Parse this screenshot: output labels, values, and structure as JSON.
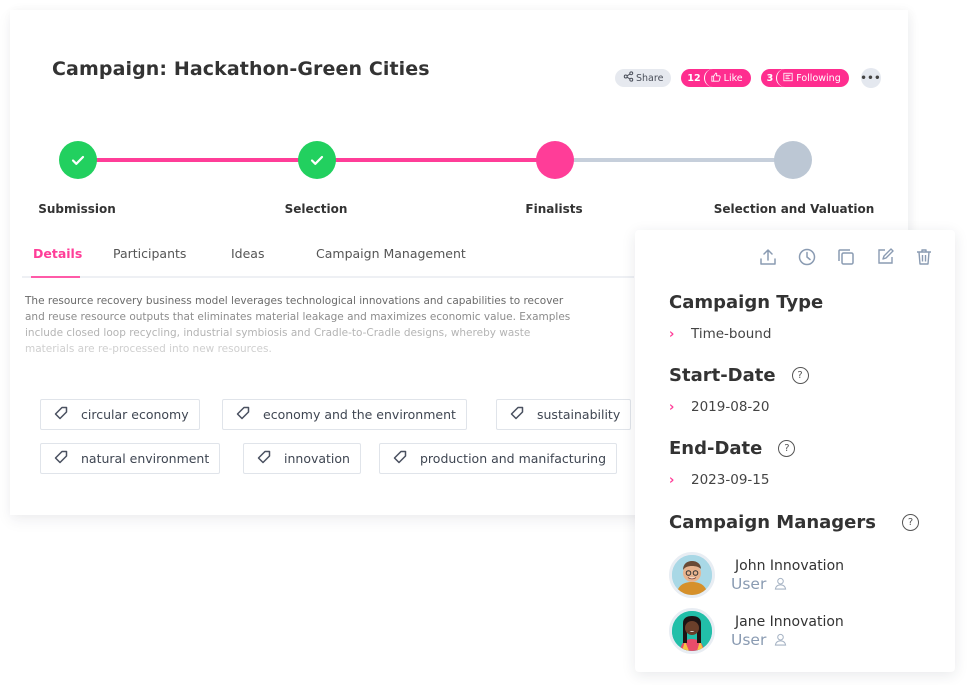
{
  "campaign": {
    "title": "Campaign: Hackathon-Green Cities"
  },
  "actions": {
    "share_label": "Share",
    "like_count": "12",
    "like_label": "Like",
    "following_count": "3",
    "following_label": "Following",
    "more_label": "•••"
  },
  "colors": {
    "accent": "#ff2d8f",
    "done": "#22d05f",
    "pending": "#bcc7d4",
    "line_done": "#ff3d98",
    "line_pending": "#c6cfdb"
  },
  "stepper": {
    "steps": [
      {
        "label": "Submission",
        "status": "completed"
      },
      {
        "label": "Selection",
        "status": "completed"
      },
      {
        "label": "Finalists",
        "status": "current"
      },
      {
        "label": "Selection and Valuation",
        "status": "pending"
      }
    ]
  },
  "tabs": [
    {
      "label": "Details",
      "active": true
    },
    {
      "label": "Participants",
      "active": false
    },
    {
      "label": "Ideas",
      "active": false
    },
    {
      "label": "Campaign Management",
      "active": false
    }
  ],
  "description": {
    "lines": [
      "The resource recovery business model leverages technological innovations and capabilities to recover",
      "and reuse resource outputs that eliminates material leakage and maximizes economic value. Examples",
      "include closed loop recycling, industrial symbiosis and Cradle-to-Cradle designs, whereby waste",
      "materials are re-processed into new resources."
    ]
  },
  "tags": [
    "circular economy",
    "economy and the environment",
    "sustainability",
    "natural environment",
    "innovation",
    "production and manifacturing"
  ],
  "panel": {
    "icons": [
      "upload-icon",
      "history-icon",
      "copy-icon",
      "edit-icon",
      "trash-icon"
    ],
    "campaign_type": {
      "title": "Campaign Type",
      "value": "Time-bound"
    },
    "start_date": {
      "title": "Start-Date",
      "value": "2019-08-20"
    },
    "end_date": {
      "title": "End-Date",
      "value": "2023-09-15"
    },
    "managers": {
      "title": "Campaign Managers",
      "help": "?",
      "items": [
        {
          "name": "John Innovation",
          "role": "User"
        },
        {
          "name": "Jane Innovation",
          "role": "User"
        }
      ]
    },
    "help": "?"
  }
}
